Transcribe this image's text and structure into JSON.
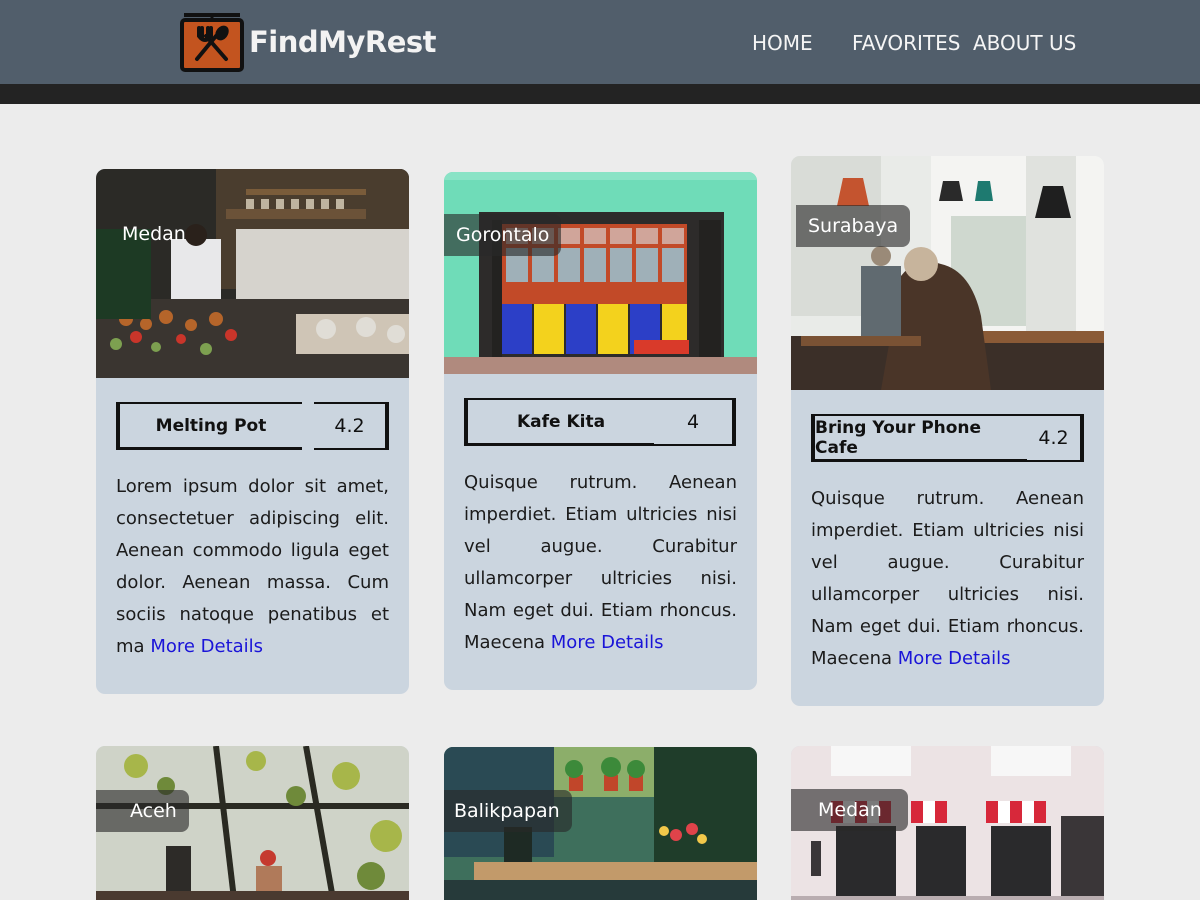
{
  "header": {
    "brand": "FindMyRest",
    "nav": [
      {
        "label": "HOME"
      },
      {
        "label": "FAVORITES"
      },
      {
        "label": "ABOUT US"
      }
    ]
  },
  "cards": [
    {
      "city": "Medan",
      "name": "Melting Pot",
      "rating": "4.2",
      "description": "Lorem ipsum dolor sit amet, consectetuer adipiscing elit. Aenean commodo ligula eget dolor. Aenean massa. Cum sociis natoque penatibus et ma",
      "more": "More Details"
    },
    {
      "city": "Gorontalo",
      "name": "Kafe Kita",
      "rating": "4",
      "description": "Quisque rutrum. Aenean imperdiet. Etiam ultricies nisi vel augue. Curabitur ullamcorper ultricies nisi. Nam eget dui. Etiam rhoncus. Maecena",
      "more": "More Details"
    },
    {
      "city": "Surabaya",
      "name": "Bring Your Phone Cafe",
      "rating": "4.2",
      "description": "Quisque rutrum. Aenean imperdiet. Etiam ultricies nisi vel augue. Curabitur ullamcorper ultricies nisi. Nam eget dui. Etiam rhoncus. Maecena",
      "more": "More Details"
    },
    {
      "city": "Aceh"
    },
    {
      "city": "Balikpapan"
    },
    {
      "city": "Medan"
    }
  ]
}
